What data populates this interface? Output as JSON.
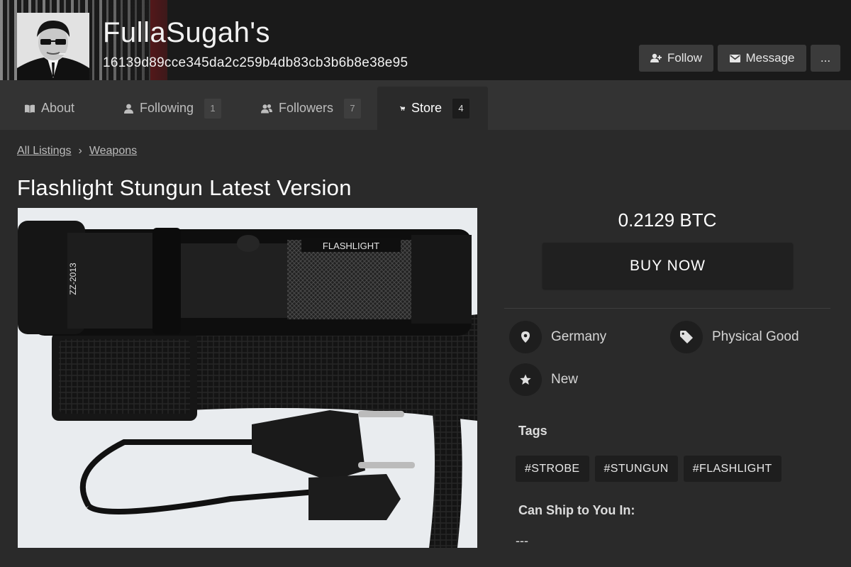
{
  "header": {
    "store_name": "FullaSugah's",
    "store_id": "16139d89cce345da2c259b4db83cb3b6b8e38e95",
    "follow_label": "Follow",
    "message_label": "Message",
    "more_label": "..."
  },
  "tabs": [
    {
      "label": "About",
      "icon": "book-icon"
    },
    {
      "label": "Following",
      "count": "1",
      "icon": "person-icon"
    },
    {
      "label": "Followers",
      "count": "7",
      "icon": "people-icon"
    },
    {
      "label": "Store",
      "count": "4",
      "icon": "cart-icon",
      "active": true
    }
  ],
  "breadcrumb": {
    "root": "All Listings",
    "separator": "›",
    "category": "Weapons"
  },
  "listing": {
    "title": "Flashlight Stungun Latest Version",
    "price": "0.2129 BTC",
    "buy_label": "BUY NOW",
    "image_text": {
      "brand": "FLASHLIGHT",
      "model": "ZZ-2013"
    },
    "details": {
      "location": "Germany",
      "type": "Physical Good",
      "condition": "New"
    },
    "tags_heading": "Tags",
    "tags": [
      "#STROBE",
      "#STUNGUN",
      "#FLASHLIGHT"
    ],
    "ship_heading": "Can Ship to You In:",
    "ship_value": "---"
  },
  "colors": {
    "background": "#2a2a2a",
    "tabbar": "#333333",
    "button": "#3b3b3b",
    "accent_red": "#b4161b"
  }
}
